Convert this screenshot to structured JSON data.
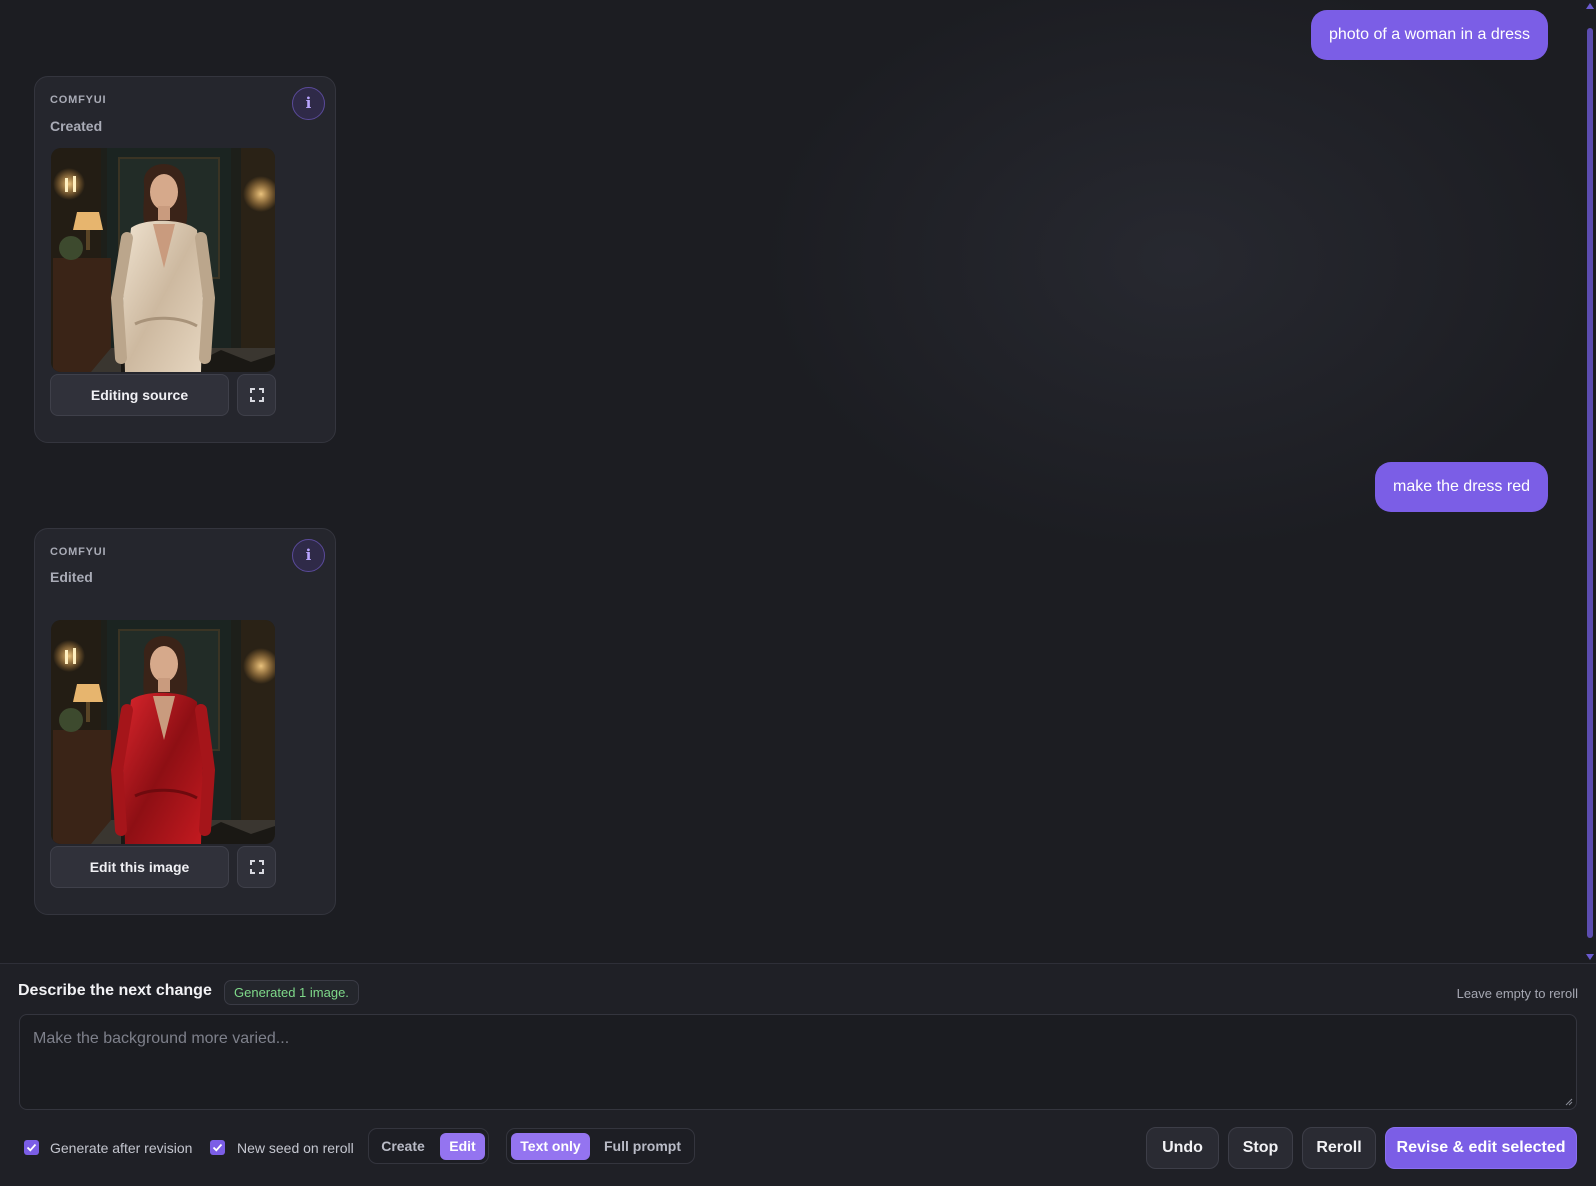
{
  "messages": {
    "user_1": "photo of a woman in a dress",
    "user_2": "make the dress red"
  },
  "cards": [
    {
      "provider": "COMFYUI",
      "status": "Created",
      "info_icon": "i",
      "action_label": "Editing source",
      "dress_color": "#d8c8b3"
    },
    {
      "provider": "COMFYUI",
      "status": "Edited",
      "info_icon": "i",
      "action_label": "Edit this image",
      "dress_color": "#b3151b"
    }
  ],
  "composer": {
    "title": "Describe the next change",
    "badge": "Generated 1 image.",
    "hint": "Leave empty to reroll",
    "placeholder": "Make the background more varied...",
    "value": ""
  },
  "options": {
    "generate_after_revision": {
      "label": "Generate after revision",
      "checked": true
    },
    "new_seed_on_reroll": {
      "label": "New seed on reroll",
      "checked": true
    }
  },
  "mode_toggle": {
    "items": [
      "Create",
      "Edit"
    ],
    "selected": "Edit"
  },
  "prompt_toggle": {
    "items": [
      "Text only",
      "Full prompt"
    ],
    "selected": "Text only"
  },
  "buttons": {
    "undo": "Undo",
    "stop": "Stop",
    "reroll": "Reroll",
    "revise": "Revise & edit selected"
  },
  "colors": {
    "accent": "#7b5ee6",
    "background": "#1c1d22",
    "success_text": "#7fd98a"
  }
}
